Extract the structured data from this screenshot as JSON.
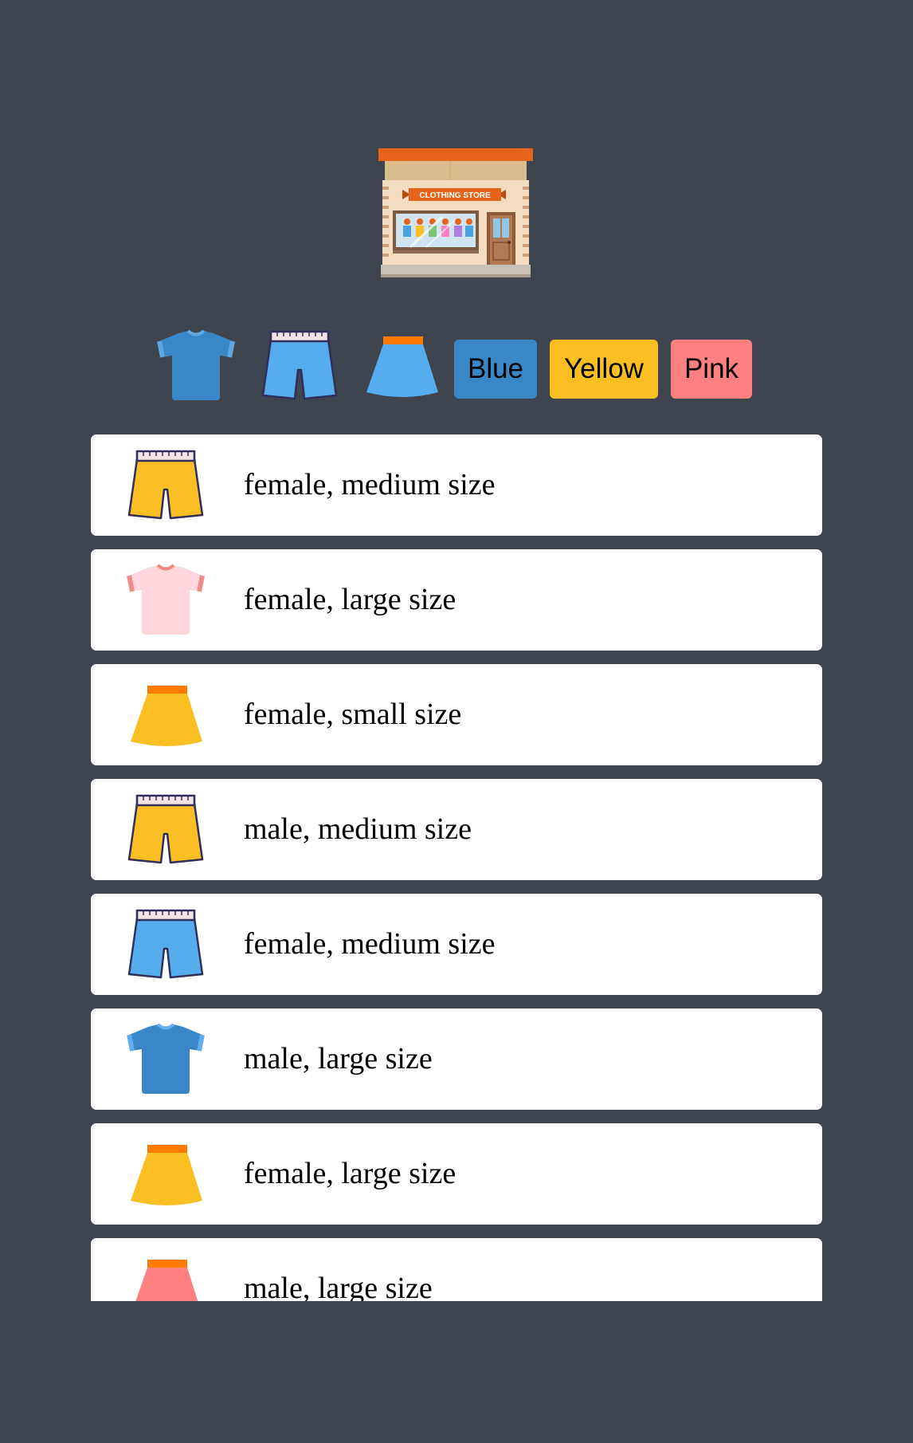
{
  "store": {
    "sign_text": "CLOTHING STORE",
    "icon": "clothing-store-icon"
  },
  "filters": {
    "types": [
      {
        "name": "shirt",
        "icon": "tshirt-icon",
        "color": "#3a87c8"
      },
      {
        "name": "shorts",
        "icon": "shorts-icon",
        "color": "#55aded"
      },
      {
        "name": "skirt",
        "icon": "skirt-icon",
        "color": "#55aded"
      }
    ],
    "colors": [
      {
        "label": "Blue",
        "color": "#3a87c8"
      },
      {
        "label": "Yellow",
        "color": "#fbbf24"
      },
      {
        "label": "Pink",
        "color": "#ff8080"
      }
    ]
  },
  "items": [
    {
      "type": "shorts",
      "color": "#fbbf24",
      "label": "female, medium size"
    },
    {
      "type": "shirt",
      "color": "#ffd6db",
      "label": "female, large size"
    },
    {
      "type": "skirt",
      "color": "#fbbf24",
      "label": "female, small size"
    },
    {
      "type": "shorts",
      "color": "#fbbf24",
      "label": "male, medium size"
    },
    {
      "type": "shorts",
      "color": "#55aded",
      "label": "female, medium size"
    },
    {
      "type": "shirt",
      "color": "#3a87c8",
      "label": "male, large size"
    },
    {
      "type": "skirt",
      "color": "#fbbf24",
      "label": "female, large size"
    },
    {
      "type": "skirt",
      "color": "#ff8080",
      "label": "male, large size"
    }
  ]
}
